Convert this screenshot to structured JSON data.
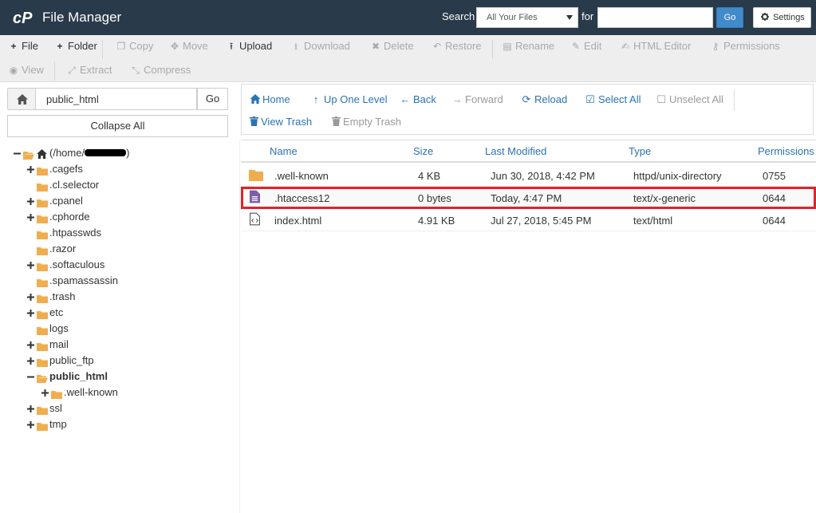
{
  "header": {
    "title": "File Manager",
    "search_label": "Search",
    "search_scope": "All Your Files",
    "for_label": "for",
    "search_value": "",
    "go_label": "Go",
    "settings_label": "Settings"
  },
  "toolbar": [
    {
      "label": "File",
      "icon": "plus-icon",
      "state": "active"
    },
    {
      "label": "Folder",
      "icon": "plus-icon",
      "state": "active"
    },
    {
      "label": "Copy",
      "icon": "copy-icon",
      "state": "disabled"
    },
    {
      "label": "Move",
      "icon": "move-icon",
      "state": "disabled"
    },
    {
      "label": "Upload",
      "icon": "upload-icon",
      "state": "active"
    },
    {
      "label": "Download",
      "icon": "download-icon",
      "state": "disabled"
    },
    {
      "label": "Delete",
      "icon": "delete-icon",
      "state": "disabled"
    },
    {
      "label": "Restore",
      "icon": "restore-icon",
      "state": "disabled"
    },
    {
      "label": "Rename",
      "icon": "rename-icon",
      "state": "disabled"
    },
    {
      "label": "Edit",
      "icon": "pencil-icon",
      "state": "disabled"
    },
    {
      "label": "HTML Editor",
      "icon": "html-editor-icon",
      "state": "disabled"
    },
    {
      "label": "Permissions",
      "icon": "key-icon",
      "state": "disabled"
    },
    {
      "label": "View",
      "icon": "eye-icon",
      "state": "disabled"
    },
    {
      "label": "Extract",
      "icon": "extract-icon",
      "state": "disabled"
    },
    {
      "label": "Compress",
      "icon": "compress-icon",
      "state": "disabled"
    }
  ],
  "path_bar": {
    "value": "public_html",
    "go_label": "Go"
  },
  "collapse_label": "Collapse All",
  "tree": [
    {
      "label": "(/home/",
      "redacted": true,
      "tail": ")",
      "toggle": "minus",
      "folder": "home"
    },
    {
      "label": ".cagefs",
      "toggle": "plus"
    },
    {
      "label": ".cl.selector",
      "toggle": "none"
    },
    {
      "label": ".cpanel",
      "toggle": "plus"
    },
    {
      "label": ".cphorde",
      "toggle": "plus"
    },
    {
      "label": ".htpasswds",
      "toggle": "none"
    },
    {
      "label": ".razor",
      "toggle": "none"
    },
    {
      "label": ".softaculous",
      "toggle": "plus"
    },
    {
      "label": ".spamassassin",
      "toggle": "none"
    },
    {
      "label": ".trash",
      "toggle": "plus"
    },
    {
      "label": "etc",
      "toggle": "plus"
    },
    {
      "label": "logs",
      "toggle": "none"
    },
    {
      "label": "mail",
      "toggle": "plus"
    },
    {
      "label": "public_ftp",
      "toggle": "plus"
    },
    {
      "label": "public_html",
      "toggle": "minus",
      "bold": true,
      "open": true
    },
    {
      "label": ".well-known",
      "toggle": "plus",
      "child": true
    },
    {
      "label": "ssl",
      "toggle": "plus"
    },
    {
      "label": "tmp",
      "toggle": "plus"
    }
  ],
  "nav": [
    {
      "label": "Home",
      "icon": "home-icon",
      "state": "active"
    },
    {
      "label": "Up One Level",
      "icon": "up-arrow-icon",
      "state": "active"
    },
    {
      "label": "Back",
      "icon": "back-arrow-icon",
      "state": "active"
    },
    {
      "label": "Forward",
      "icon": "forward-arrow-icon",
      "state": "disabled"
    },
    {
      "label": "Reload",
      "icon": "reload-icon",
      "state": "active"
    },
    {
      "label": "Select All",
      "icon": "checkbox-checked-icon",
      "state": "active"
    },
    {
      "label": "Unselect All",
      "icon": "checkbox-empty-icon",
      "state": "disabled"
    },
    {
      "label": "View Trash",
      "icon": "trash-icon",
      "state": "active"
    },
    {
      "label": "Empty Trash",
      "icon": "trash-icon",
      "state": "disabled"
    }
  ],
  "columns": [
    "Name",
    "Size",
    "Last Modified",
    "Type",
    "Permissions"
  ],
  "files": [
    {
      "name": ".well-known",
      "size": "4 KB",
      "modified": "Jun 30, 2018, 4:42 PM",
      "type": "httpd/unix-directory",
      "perms": "0755",
      "icon": "folder-icon"
    },
    {
      "name": ".htaccess12",
      "size": "0 bytes",
      "modified": "Today, 4:47 PM",
      "type": "text/x-generic",
      "perms": "0644",
      "icon": "text-file-icon",
      "highlighted": true
    },
    {
      "name": "index.html",
      "size": "4.91 KB",
      "modified": "Jul 27, 2018, 5:45 PM",
      "type": "text/html",
      "perms": "0644",
      "icon": "code-file-icon"
    }
  ],
  "colors": {
    "header_bg": "#293a4a",
    "link_blue": "#2a73b5",
    "go_blue": "#428bca",
    "folder_orange": "#f0ad4e",
    "highlight_red": "#e32228",
    "file_purple": "#7b5ea7"
  }
}
